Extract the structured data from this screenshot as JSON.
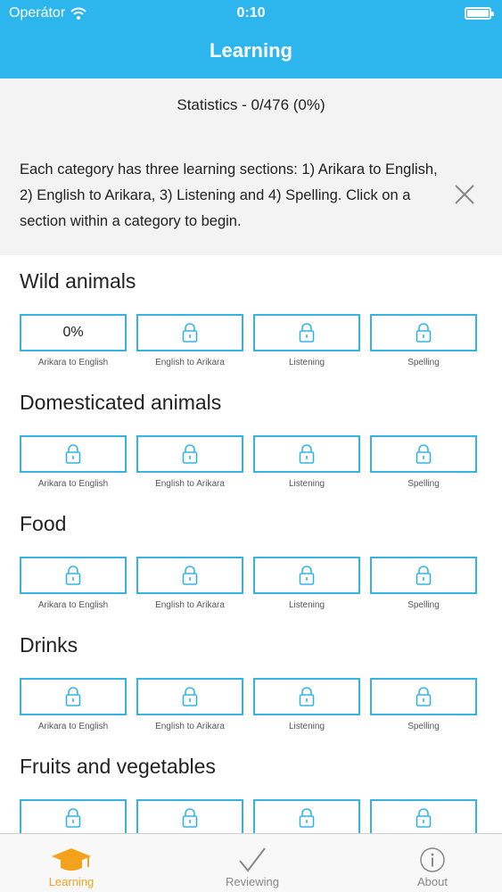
{
  "status_bar": {
    "carrier": "Operátor",
    "time": "0:10"
  },
  "nav": {
    "title": "Learning"
  },
  "stats": {
    "text": "Statistics - 0/476 (0%)",
    "info": "Each category has three learning sections: 1) Arikara to English, 2) English to Arikara, 3) Listening and 4) Spelling. Click on a section within a category to begin."
  },
  "categories": [
    {
      "title": "Wild animals",
      "sections": [
        {
          "label": "Arikara to English",
          "value": "0%",
          "locked": false
        },
        {
          "label": "English to Arikara",
          "locked": true
        },
        {
          "label": "Listening",
          "locked": true
        },
        {
          "label": "Spelling",
          "locked": true
        }
      ]
    },
    {
      "title": "Domesticated animals",
      "sections": [
        {
          "label": "Arikara to English",
          "locked": true
        },
        {
          "label": "English to Arikara",
          "locked": true
        },
        {
          "label": "Listening",
          "locked": true
        },
        {
          "label": "Spelling",
          "locked": true
        }
      ]
    },
    {
      "title": "Food",
      "sections": [
        {
          "label": "Arikara to English",
          "locked": true
        },
        {
          "label": "English to Arikara",
          "locked": true
        },
        {
          "label": "Listening",
          "locked": true
        },
        {
          "label": "Spelling",
          "locked": true
        }
      ]
    },
    {
      "title": "Drinks",
      "sections": [
        {
          "label": "Arikara to English",
          "locked": true
        },
        {
          "label": "English to Arikara",
          "locked": true
        },
        {
          "label": "Listening",
          "locked": true
        },
        {
          "label": "Spelling",
          "locked": true
        }
      ]
    },
    {
      "title": "Fruits and vegetables",
      "sections": [
        {
          "label": "",
          "locked": true
        },
        {
          "label": "",
          "locked": true
        },
        {
          "label": "",
          "locked": true
        },
        {
          "label": "",
          "locked": true
        }
      ]
    }
  ],
  "tabs": [
    {
      "label": "Learning",
      "icon": "graduation-cap-icon",
      "active": true
    },
    {
      "label": "Reviewing",
      "icon": "checkmark-icon",
      "active": false
    },
    {
      "label": "About",
      "icon": "info-icon",
      "active": false
    }
  ],
  "colors": {
    "accent": "#2db6ee",
    "border": "#35b4e4",
    "active_tab": "#f4a11c"
  }
}
